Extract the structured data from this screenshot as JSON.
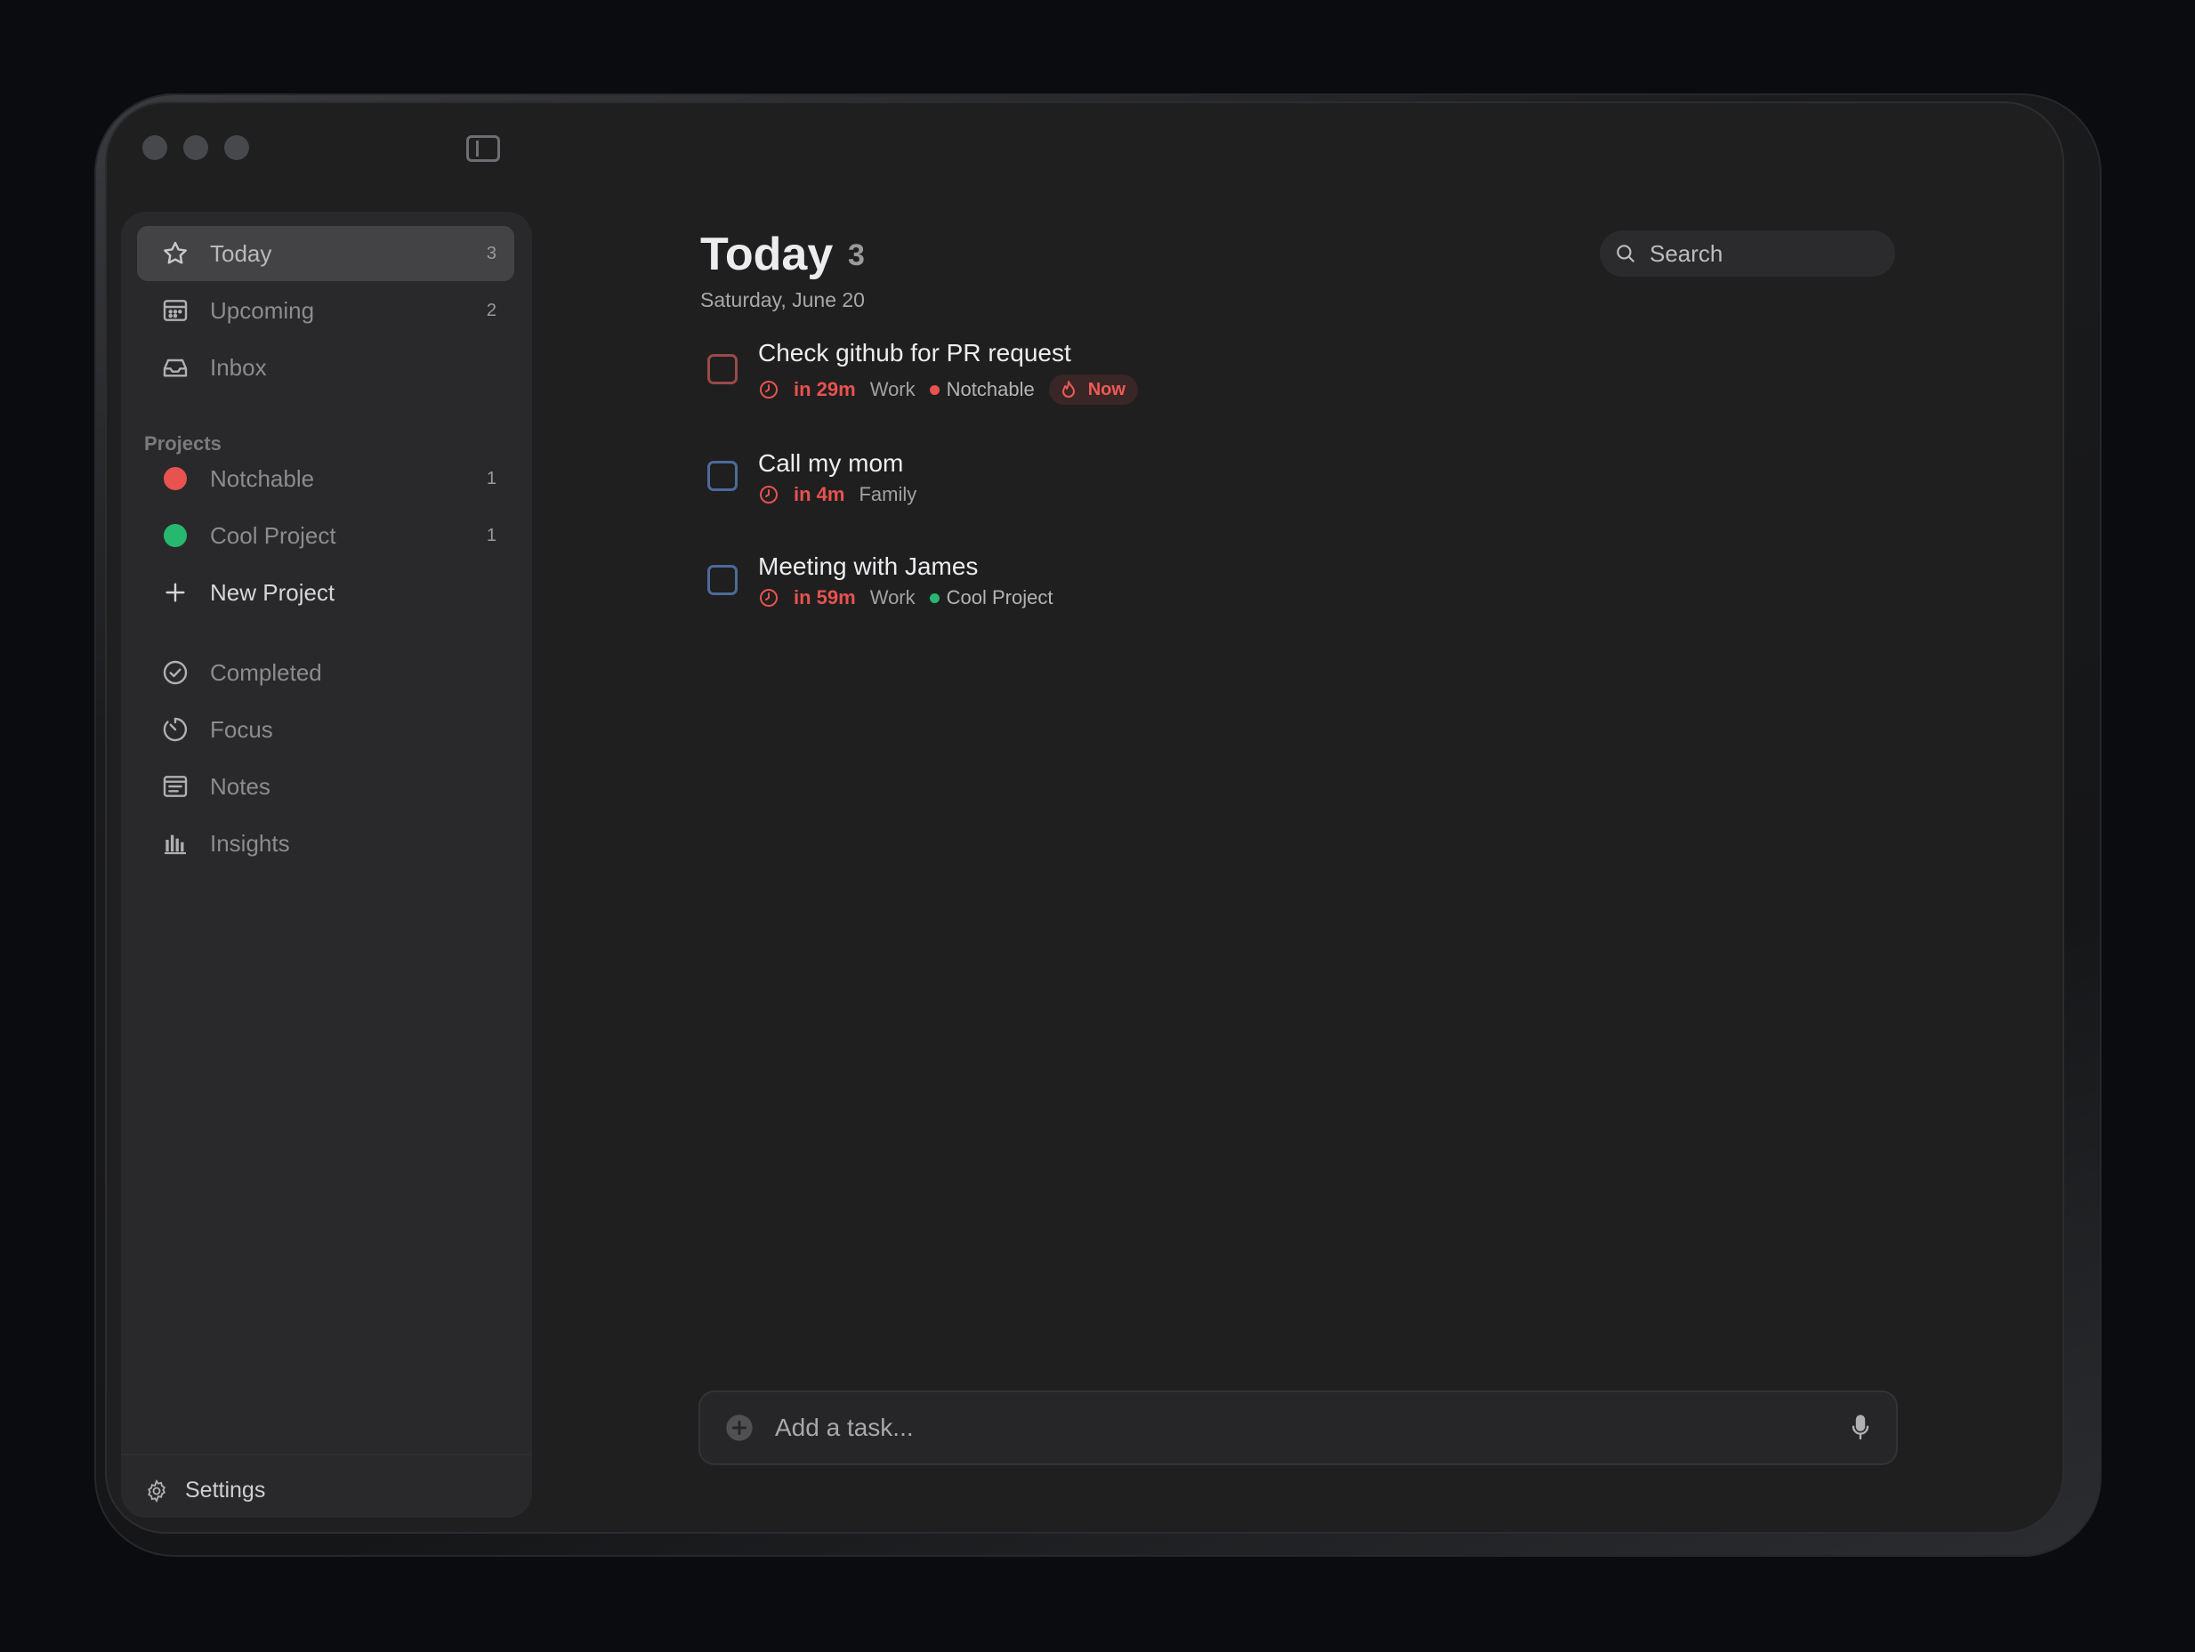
{
  "window": {
    "traffic_lights": [
      "close",
      "minimize",
      "zoom"
    ]
  },
  "sidebar": {
    "primary_items": [
      {
        "label": "Today",
        "count": "3",
        "icon": "star-icon"
      },
      {
        "label": "Upcoming",
        "count": "2",
        "icon": "calendar-icon"
      },
      {
        "label": "Inbox",
        "count": "",
        "icon": "inbox-icon"
      }
    ],
    "projects_label": "Projects",
    "projects": [
      {
        "label": "Notchable",
        "count": "1",
        "color": "#e8524f"
      },
      {
        "label": "Cool Project",
        "count": "1",
        "color": "#27b86f"
      }
    ],
    "new_project_label": "New Project",
    "secondary_items": [
      {
        "label": "Completed",
        "icon": "check-circle-icon"
      },
      {
        "label": "Focus",
        "icon": "timer-icon"
      },
      {
        "label": "Notes",
        "icon": "notes-icon"
      },
      {
        "label": "Insights",
        "icon": "bar-chart-icon"
      }
    ],
    "settings_label": "Settings"
  },
  "main": {
    "title": "Today",
    "title_count": "3",
    "date": "Saturday, June 20",
    "search_placeholder": "Search",
    "tasks": [
      {
        "title": "Check github for PR request",
        "due": "in 29m",
        "tag": "Work",
        "project": "Notchable",
        "project_color": "#e8524f",
        "badge": "Now",
        "checkbox_color": "#9b4a48"
      },
      {
        "title": "Call my mom",
        "due": "in 4m",
        "tag": "Family",
        "project": "",
        "project_color": "",
        "badge": "",
        "checkbox_color": "#4d6a9a"
      },
      {
        "title": "Meeting with James",
        "due": "in 59m",
        "tag": "Work",
        "project": "Cool Project",
        "project_color": "#27b86f",
        "badge": "",
        "checkbox_color": "#4d6a9a"
      }
    ],
    "add_task_placeholder": "Add a task..."
  },
  "colors": {
    "accent_red": "#e8524f",
    "accent_green": "#27b86f",
    "background": "#1f1f20",
    "sidebar": "#29292b"
  }
}
